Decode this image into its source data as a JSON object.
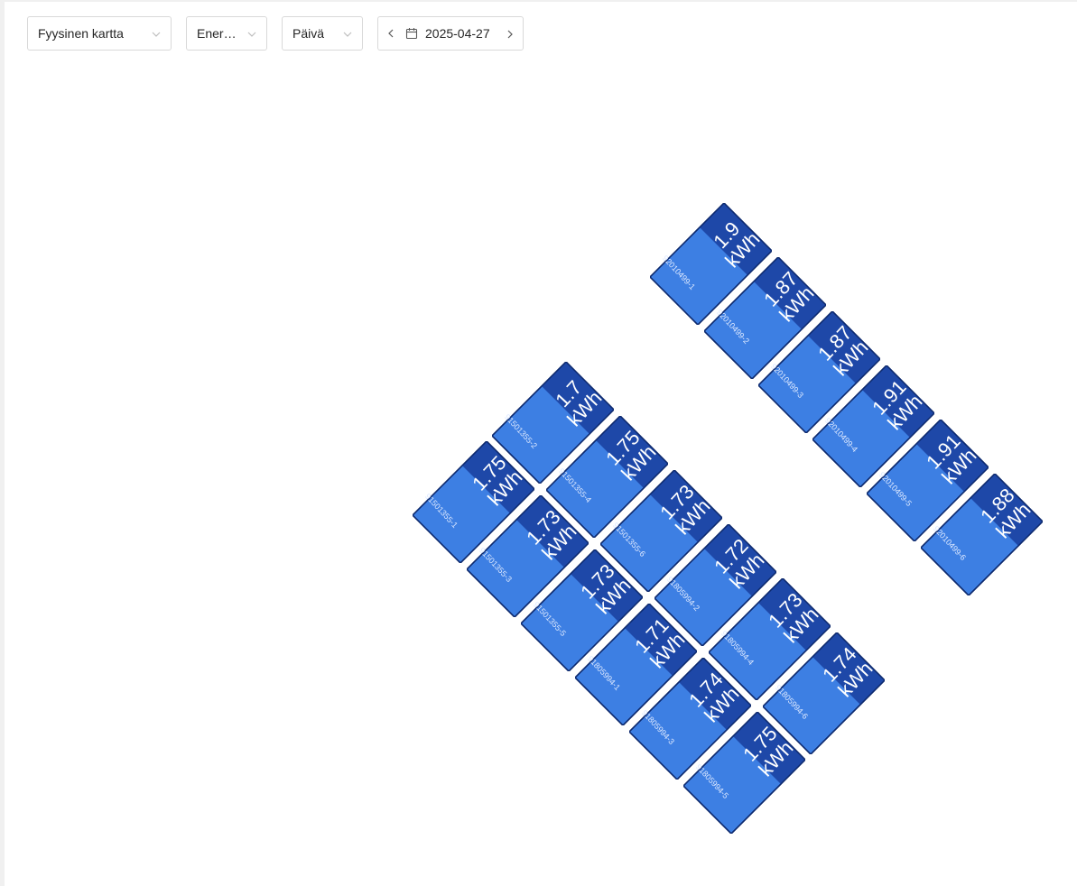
{
  "toolbar": {
    "view_select": "Fyysinen kartta",
    "metric_select": "Ener…",
    "period_select": "Päivä",
    "date": "2025-04-27"
  },
  "panels": [
    {
      "serial": "92010499-1",
      "value": "1.9",
      "unit": "kWh"
    },
    {
      "serial": "92010499-2",
      "value": "1.87",
      "unit": "kWh"
    },
    {
      "serial": "92010499-3",
      "value": "1.87",
      "unit": "kWh"
    },
    {
      "serial": "92010499-4",
      "value": "1.91",
      "unit": "kWh"
    },
    {
      "serial": "92010499-5",
      "value": "1.91",
      "unit": "kWh"
    },
    {
      "serial": "92010499-6",
      "value": "1.88",
      "unit": "kWh"
    },
    {
      "serial": "91501355-2",
      "value": "1.7",
      "unit": "kWh"
    },
    {
      "serial": "91501355-4",
      "value": "1.75",
      "unit": "kWh"
    },
    {
      "serial": "91501355-6",
      "value": "1.73",
      "unit": "kWh"
    },
    {
      "serial": "91805994-2",
      "value": "1.72",
      "unit": "kWh"
    },
    {
      "serial": "91805994-4",
      "value": "1.73",
      "unit": "kWh"
    },
    {
      "serial": "91805994-6",
      "value": "1.74",
      "unit": "kWh"
    },
    {
      "serial": "91501355-1",
      "value": "1.75",
      "unit": "kWh"
    },
    {
      "serial": "91501355-3",
      "value": "1.73",
      "unit": "kWh"
    },
    {
      "serial": "91501355-5",
      "value": "1.73",
      "unit": "kWh"
    },
    {
      "serial": "91805994-1",
      "value": "1.71",
      "unit": "kWh"
    },
    {
      "serial": "91805994-3",
      "value": "1.74",
      "unit": "kWh"
    },
    {
      "serial": "91805994-5",
      "value": "1.75",
      "unit": "kWh"
    }
  ],
  "colors": {
    "panel_light": "#3d7fe3",
    "panel_dark": "#1e48a8",
    "panel_border": "#0e2a6e"
  }
}
